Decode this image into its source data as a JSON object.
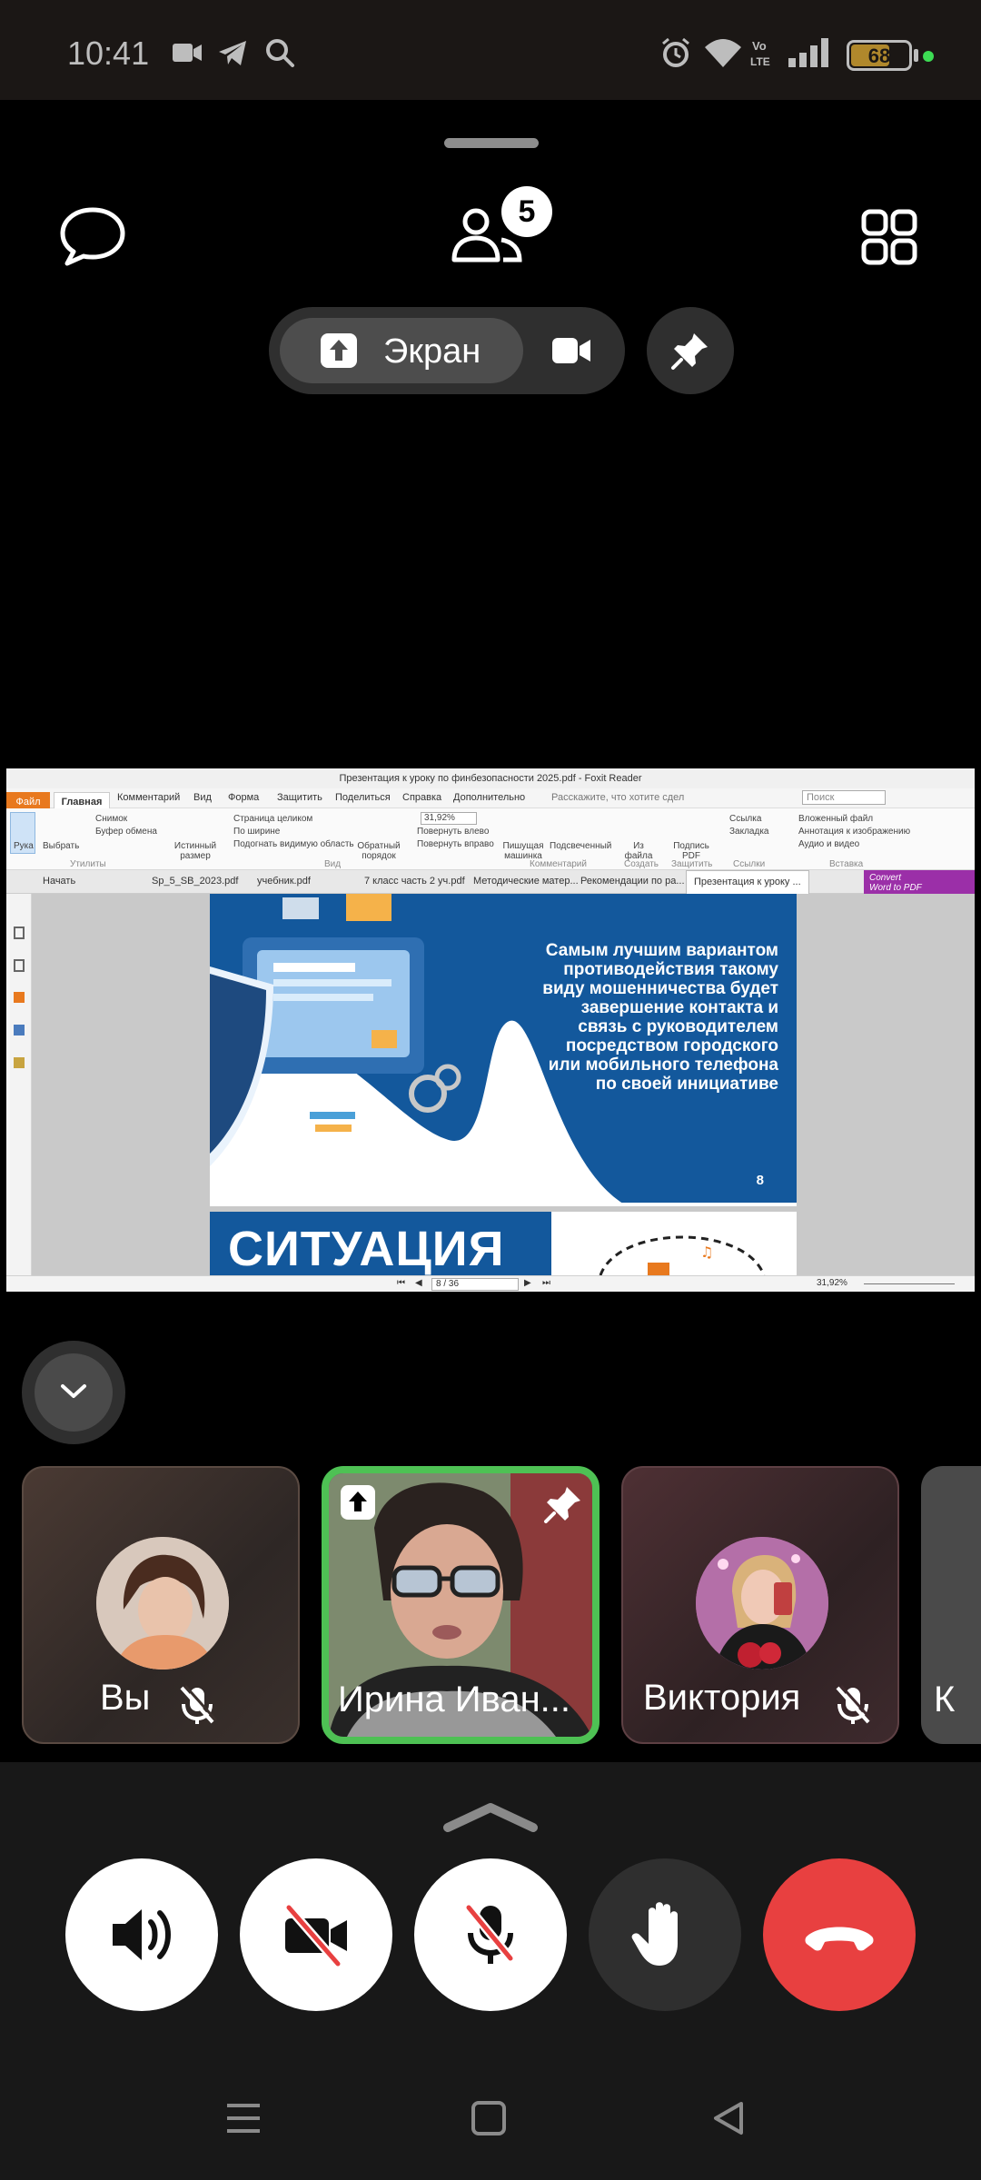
{
  "status_bar": {
    "time": "10:41",
    "battery_level": "68",
    "battery_fraction": 0.68,
    "icons": [
      "video-icon",
      "telegram-icon",
      "search-icon",
      "alarm-icon",
      "wifi-icon",
      "volte-icon",
      "signal-icon"
    ]
  },
  "call_header": {
    "participants_count": "5",
    "screen_share_label": "Экран"
  },
  "shared_screen": {
    "window_title": "Презентация к уроку по финбезопасности 2025.pdf - Foxit Reader",
    "menu": [
      "Файл",
      "Главная",
      "Комментарий",
      "Вид",
      "Форма",
      "Защитить",
      "Поделиться",
      "Справка",
      "Дополнительно"
    ],
    "tell_me": "Расскажите, что хотите сдел",
    "search_placeholder": "Поиск",
    "ribbon": {
      "hand": "Рука",
      "select": "Выбрать",
      "snapshot": "Снимок",
      "clipboard": "Буфер обмена",
      "utilities": "Утилиты",
      "actual_size": "Истинный размер",
      "fit_page": "Страница целиком",
      "fit_width": "По ширине",
      "fit_visible": "Подогнать видимую область",
      "view_group": "Вид",
      "reflow": "Обратный порядок",
      "zoom": "31,92%",
      "rotate_left": "Повернуть влево",
      "rotate_right": "Повернуть вправо",
      "typewriter": "Пишущая машинка",
      "highlight": "Подсвеченный",
      "comment_group": "Комментарий",
      "from_file": "Из файла",
      "create_group": "Создать",
      "sign_pdf": "Подпись PDF",
      "protect_group": "Защитить",
      "link": "Ссылка",
      "bookmark": "Закладка",
      "links_group": "Ссылки",
      "attached_file": "Вложенный файл",
      "image_annotation": "Аннотация к изображению",
      "audio_video": "Аудио и видео",
      "insert_group": "Вставка"
    },
    "convert_title": "Convert",
    "convert_subtitle": "Word to PDF",
    "tabs": [
      "Начать",
      "Sp_5_SB_2023.pdf",
      "учебник.pdf",
      "7 класс часть 2 уч.pdf",
      "Методические матер...",
      "Рекомендации по ра...",
      "Презентация к уроку ..."
    ],
    "slide_text": "Самым лучшим вариантом\nпротиводействия такому\nвиду мошенничества будет\nзавершение контакта и\nсвязь с руководителем\nпосредством городского\nили мобильного телефона\nпо своей инициативе",
    "slide_number": "8",
    "next_slide_title": "СИТУАЦИЯ",
    "page_indicator": "8 / 36",
    "status_zoom": "31,92%"
  },
  "participants": [
    {
      "name": "Вы",
      "muted": true
    },
    {
      "name": "Ирина Иван...",
      "muted": false,
      "sharing": true,
      "pinned": true
    },
    {
      "name": "Виктория",
      "muted": true
    },
    {
      "name": "К",
      "muted": false
    }
  ],
  "controls": [
    "speaker-button",
    "camera-off-button",
    "mic-off-button",
    "raise-hand-button",
    "end-call-button"
  ],
  "colors": {
    "active_speaker": "#4ec154",
    "end_call": "#e84040",
    "slide_blue": "#13589c",
    "foxit_orange": "#e8791e"
  }
}
